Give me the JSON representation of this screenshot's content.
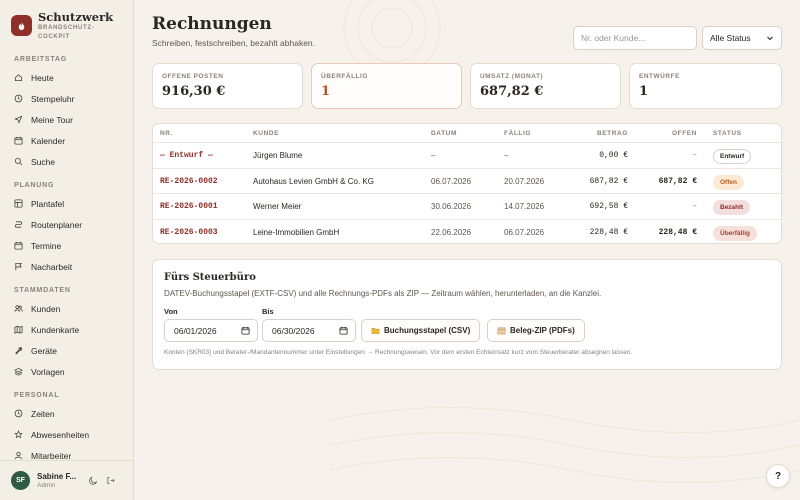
{
  "brand": {
    "title": "Schutzwerk",
    "subtitle_1": "BRANDSCHUTZ-",
    "subtitle_2": "COCKPIT"
  },
  "sidebar": {
    "sections": [
      {
        "title": "ARBEITSTAG",
        "items": [
          {
            "label": "Heute",
            "icon": "home-icon"
          },
          {
            "label": "Stempeluhr",
            "icon": "clock-icon"
          },
          {
            "label": "Meine Tour",
            "icon": "navigation-icon"
          },
          {
            "label": "Kalender",
            "icon": "calendar-icon"
          },
          {
            "label": "Suche",
            "icon": "search-icon"
          }
        ]
      },
      {
        "title": "PLANUNG",
        "items": [
          {
            "label": "Plantafel",
            "icon": "board-icon"
          },
          {
            "label": "Routenplaner",
            "icon": "route-icon"
          },
          {
            "label": "Termine",
            "icon": "calendar-icon"
          },
          {
            "label": "Nacharbeit",
            "icon": "flag-icon"
          }
        ]
      },
      {
        "title": "STAMMDATEN",
        "items": [
          {
            "label": "Kunden",
            "icon": "users-icon"
          },
          {
            "label": "Kundenkarte",
            "icon": "map-icon"
          },
          {
            "label": "Geräte",
            "icon": "wrench-icon"
          },
          {
            "label": "Vorlagen",
            "icon": "layers-icon"
          }
        ]
      },
      {
        "title": "PERSONAL",
        "items": [
          {
            "label": "Zeiten",
            "icon": "clock-icon"
          },
          {
            "label": "Abwesenheiten",
            "icon": "star-icon"
          },
          {
            "label": "Mitarbeiter",
            "icon": "user-icon"
          }
        ]
      }
    ]
  },
  "user": {
    "initials": "SF",
    "name": "Sabine F...",
    "role": "Admin"
  },
  "header": {
    "title": "Rechnungen",
    "subtitle": "Schreiben, festschreiben, bezahlt abhaken.",
    "search_placeholder": "Nr. oder Kunde...",
    "status_filter": "Alle Status"
  },
  "stats": [
    {
      "label": "OFFENE POSTEN",
      "value": "916,30 €"
    },
    {
      "label": "ÜBERFÄLLIG",
      "value": "1"
    },
    {
      "label": "UMSATZ (MONAT)",
      "value": "687,82 €"
    },
    {
      "label": "ENTWÜRFE",
      "value": "1"
    }
  ],
  "table": {
    "headers": {
      "nr": "NR.",
      "kunde": "KUNDE",
      "datum": "DATUM",
      "faellig": "FÄLLIG",
      "betrag": "BETRAG",
      "offen": "OFFEN",
      "status": "STATUS"
    },
    "rows": [
      {
        "nr": "— Entwurf —",
        "kunde": "Jürgen Blume",
        "datum": "–",
        "faellig": "–",
        "betrag": "0,00 €",
        "offen": "–",
        "status": "Entwurf"
      },
      {
        "nr": "RE-2026-0002",
        "kunde": "Autohaus Levien GmbH & Co. KG",
        "datum": "06.07.2026",
        "faellig": "20.07.2026",
        "betrag": "687,82 €",
        "offen": "687,82 €",
        "status": "Offen"
      },
      {
        "nr": "RE-2026-0001",
        "kunde": "Werner Meier",
        "datum": "30.06.2026",
        "faellig": "14.07.2026",
        "betrag": "692,58 €",
        "offen": "–",
        "status": "Bezahlt"
      },
      {
        "nr": "RE-2026-0003",
        "kunde": "Leine-Immobilien GmbH",
        "datum": "22.06.2026",
        "faellig": "06.07.2026",
        "betrag": "228,48 €",
        "offen": "228,48 €",
        "status": "Überfällig"
      }
    ]
  },
  "status_colors": {
    "Entwurf": {
      "bg": "#ffffff",
      "fg": "#2b2622",
      "border": "#d9d1c5"
    },
    "Offen": {
      "bg": "#fbe9d3",
      "fg": "#b0601f",
      "border": "#fbe9d3"
    },
    "Bezahlt": {
      "bg": "#f3dede",
      "fg": "#8f2f2a",
      "border": "#f3dede"
    },
    "Überfällig": {
      "bg": "#f8e0da",
      "fg": "#a8402f",
      "border": "#f8e0da"
    }
  },
  "export": {
    "title": "Fürs Steuerbüro",
    "description": "DATEV-Buchungsstapel (EXTF-CSV) und alle Rechnungs-PDFs als ZIP — Zeitraum wählen, herunterladen, an die Kanzlei.",
    "from_label": "Von",
    "from_value": "06/01/2026",
    "to_label": "Bis",
    "to_value": "06/30/2026",
    "csv_button": "Buchungsstapel (CSV)",
    "zip_button": "Beleg-ZIP (PDFs)",
    "note": "Konten (SKR03) und Berater-/Mandantennummer unter Einstellungen → Rechnungswesen. Vor dem ersten Echteinsatz kurz vom Steuerberater absegnen lassen."
  },
  "help_label": "?",
  "colors": {
    "accent": "#8f2f2a",
    "background": "#f6f1ea",
    "avatar": "#2f5a44"
  }
}
